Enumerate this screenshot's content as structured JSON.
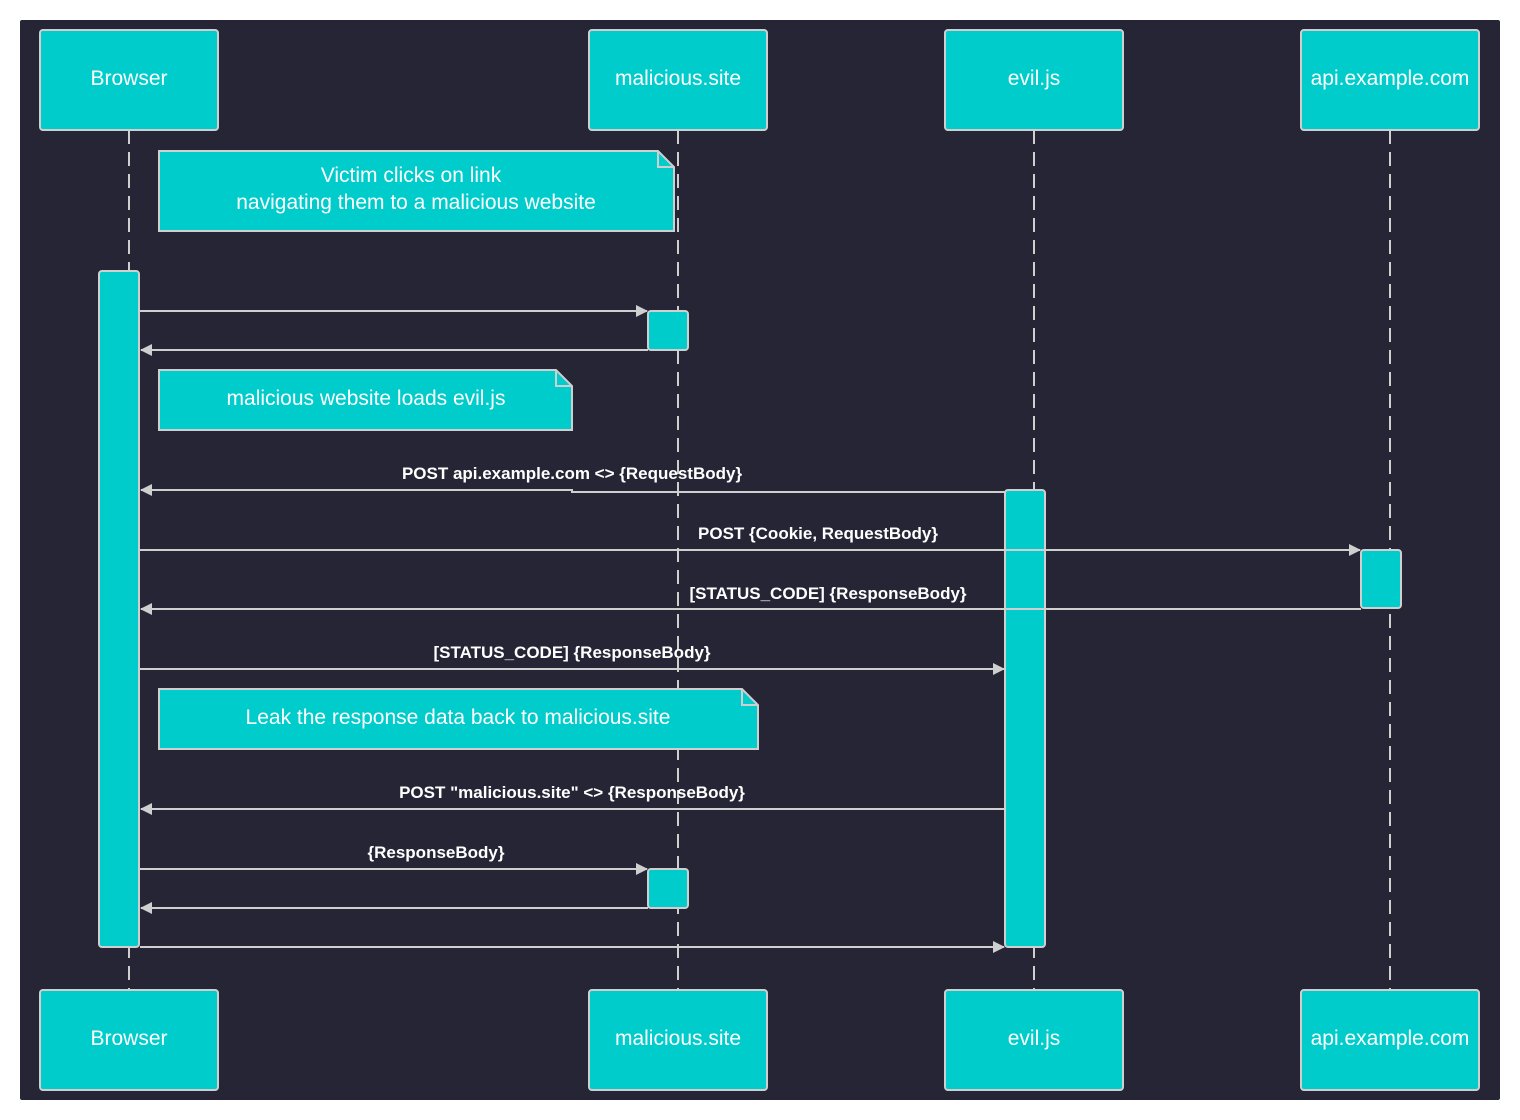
{
  "diagram": {
    "type": "sequence",
    "colors": {
      "background": "#252536",
      "actor_fill": "#00cccc",
      "actor_border": "#cfcfcf",
      "line": "#cfcfcf",
      "text": "#ffffff"
    },
    "participants": [
      {
        "id": "browser",
        "label": "Browser"
      },
      {
        "id": "malicious",
        "label": "malicious.site"
      },
      {
        "id": "evil",
        "label": "evil.js"
      },
      {
        "id": "api",
        "label": "api.example.com"
      }
    ],
    "notes": [
      {
        "lines": [
          "Victim clicks on link",
          "navigating them to a malicious website"
        ]
      },
      {
        "lines": [
          "malicious website loads evil.js"
        ]
      },
      {
        "lines": [
          "Leak the response data back to malicious.site"
        ]
      }
    ],
    "messages": [
      {
        "from": "browser",
        "to": "malicious",
        "label": ""
      },
      {
        "from": "malicious",
        "to": "browser",
        "label": ""
      },
      {
        "from": "evil",
        "to": "browser",
        "label": "POST api.example.com <> {RequestBody}"
      },
      {
        "from": "browser",
        "to": "api",
        "label": "POST {Cookie, RequestBody}"
      },
      {
        "from": "api",
        "to": "browser",
        "label": "[STATUS_CODE] {ResponseBody}"
      },
      {
        "from": "browser",
        "to": "evil",
        "label": "[STATUS_CODE] {ResponseBody}"
      },
      {
        "from": "evil",
        "to": "browser",
        "label": "POST \"malicious.site\" <> {ResponseBody}"
      },
      {
        "from": "browser",
        "to": "malicious",
        "label": "{ResponseBody}"
      },
      {
        "from": "malicious",
        "to": "browser",
        "label": ""
      },
      {
        "from": "browser",
        "to": "evil",
        "label": ""
      }
    ]
  }
}
